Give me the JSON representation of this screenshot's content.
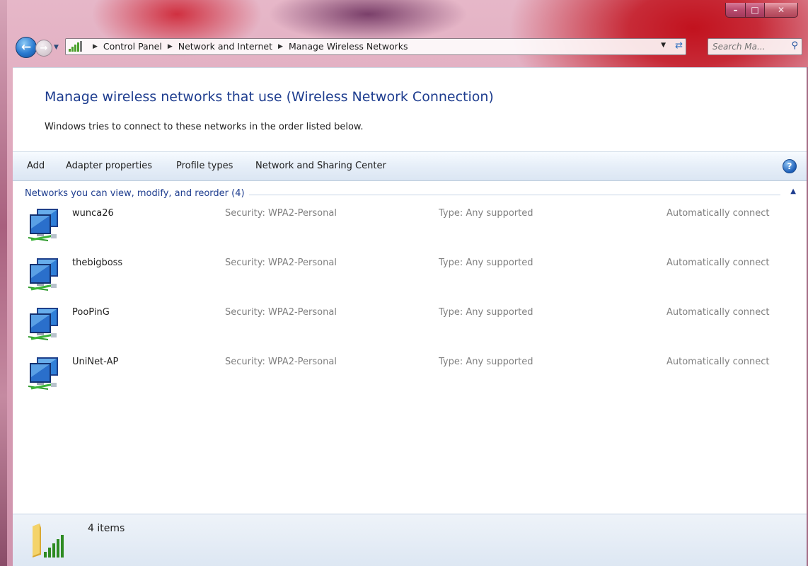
{
  "window": {
    "controls": {
      "minimize": "–",
      "maximize": "□",
      "close": "✕"
    }
  },
  "nav": {
    "back_icon": "back-arrow-icon",
    "forward_icon": "forward-arrow-icon",
    "breadcrumbs": [
      "Control Panel",
      "Network and Internet",
      "Manage Wireless Networks"
    ],
    "search_placeholder": "Search Ma..."
  },
  "page": {
    "title": "Manage wireless networks that use (Wireless Network Connection)",
    "subtitle": "Windows tries to connect to these networks in the order listed below."
  },
  "toolbar": {
    "items": [
      "Add",
      "Adapter properties",
      "Profile types",
      "Network and Sharing Center"
    ],
    "help_label": "?"
  },
  "group": {
    "header": "Networks you can view, modify, and reorder (4)"
  },
  "networks": [
    {
      "name": "wunca26",
      "security": "Security: WPA2-Personal",
      "type": "Type: Any supported",
      "mode": "Automatically connect"
    },
    {
      "name": "thebigboss",
      "security": "Security: WPA2-Personal",
      "type": "Type: Any supported",
      "mode": "Automatically connect"
    },
    {
      "name": "PooPinG",
      "security": "Security: WPA2-Personal",
      "type": "Type: Any supported",
      "mode": "Automatically connect"
    },
    {
      "name": "UniNet-AP",
      "security": "Security: WPA2-Personal",
      "type": "Type: Any supported",
      "mode": "Automatically connect"
    }
  ],
  "status": {
    "count_text": "4 items"
  },
  "colors": {
    "link_blue": "#1e3d8f",
    "muted_gray": "#808080",
    "signal_green": "#4aa02a"
  }
}
